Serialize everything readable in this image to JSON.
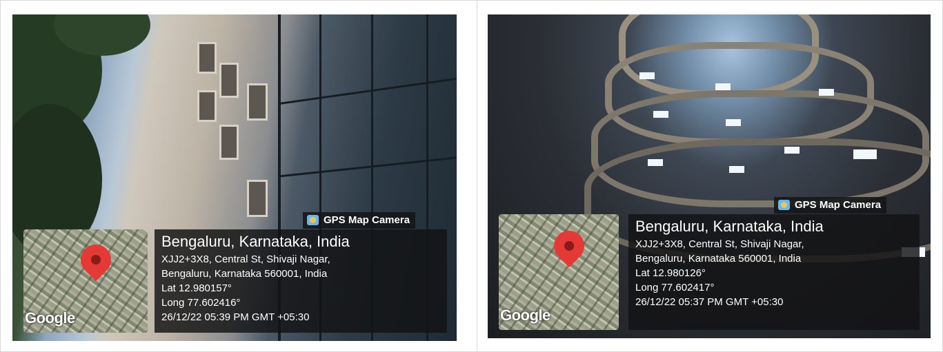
{
  "left": {
    "badge": "GPS Map Camera",
    "map_brand": "Google",
    "title": "Bengaluru, Karnataka, India",
    "address_line1": "XJJ2+3X8, Central St, Shivaji Nagar,",
    "address_line2": "Bengaluru, Karnataka 560001, India",
    "lat": "Lat 12.980157°",
    "long": "Long 77.602416°",
    "timestamp": "26/12/22 05:39 PM GMT +05:30"
  },
  "right": {
    "badge": "GPS Map Camera",
    "map_brand": "Google",
    "title": "Bengaluru, Karnataka, India",
    "address_line1": "XJJ2+3X8, Central St, Shivaji Nagar,",
    "address_line2": "Bengaluru, Karnataka 560001, India",
    "lat": "Lat 12.980126°",
    "long": "Long 77.602417°",
    "timestamp": "26/12/22 05:37 PM GMT +05:30"
  },
  "colors": {
    "pin": "#e53935",
    "overlay": "#121214",
    "camera_icon": "#6fb6e8"
  },
  "icons": {
    "badge": "camera-icon",
    "map": "map-pin-icon"
  }
}
